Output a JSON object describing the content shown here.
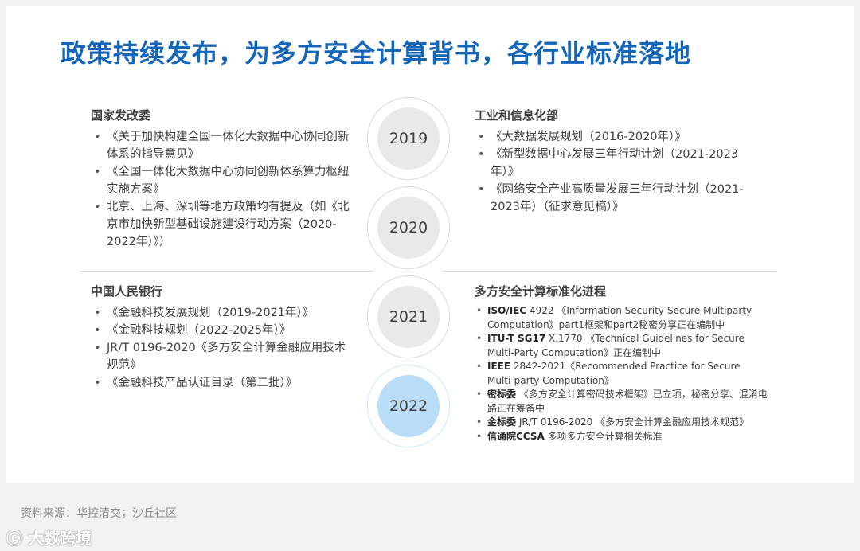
{
  "title": "政策持续发布，为多方安全计算背书，各行业标准落地",
  "timeline": [
    "2019",
    "2020",
    "2021",
    "2022"
  ],
  "highlight_color": "#b9dcf7",
  "sections": {
    "top_left": {
      "heading": "国家发改委",
      "items": [
        "《关于加快构建全国一体化大数据中心协同创新体系的指导意见》",
        "《全国一体化大数据中心协同创新体系算力枢纽实施方案》",
        "北京、上海、深圳等地方政策均有提及（如《北京市加快新型基础设施建设行动方案（2020-2022年）》）"
      ]
    },
    "top_right": {
      "heading": "工业和信息化部",
      "items": [
        "《大数据发展规划（2016-2020年）》",
        "《新型数据中心发展三年行动计划（2021-2023年）》",
        "《网络安全产业高质量发展三年行动计划（2021-2023年）（征求意见稿）》"
      ]
    },
    "bottom_left": {
      "heading": "中国人民银行",
      "items": [
        "《金融科技发展规划（2019-2021年）》",
        "《金融科技规划（2022-2025年）》",
        "JR/T 0196-2020《多方安全计算金融应用技术规范》",
        "《金融科技产品认证目录（第二批）》"
      ]
    },
    "bottom_right": {
      "heading": "多方安全计算标准化进程",
      "items": [
        {
          "org": "ISO/IEC",
          "text": " 4922 《Information Security-Secure Multiparty Computation》part1框架和part2秘密分享正在编制中"
        },
        {
          "org": "ITU-T SG17",
          "text": " X.1770 《Technical Guidelines for Secure Multi-Party Computation》正在编制中"
        },
        {
          "org": "IEEE",
          "text": " 2842-2021《Recommended Practice for Secure Multi-party Computation》"
        },
        {
          "org": "密标委",
          "text": " 《多方安全计算密码技术框架》已立项，秘密分享、混淆电路正在筹备中"
        },
        {
          "org": "金标委",
          "text": " JR/T 0196-2020 《多方安全计算金融应用技术规范》"
        },
        {
          "org": "信通院CCSA",
          "text": " 多项多方安全计算相关标准"
        }
      ]
    }
  },
  "source": "资料来源：华控清交；沙丘社区",
  "watermark": "大数跨境"
}
